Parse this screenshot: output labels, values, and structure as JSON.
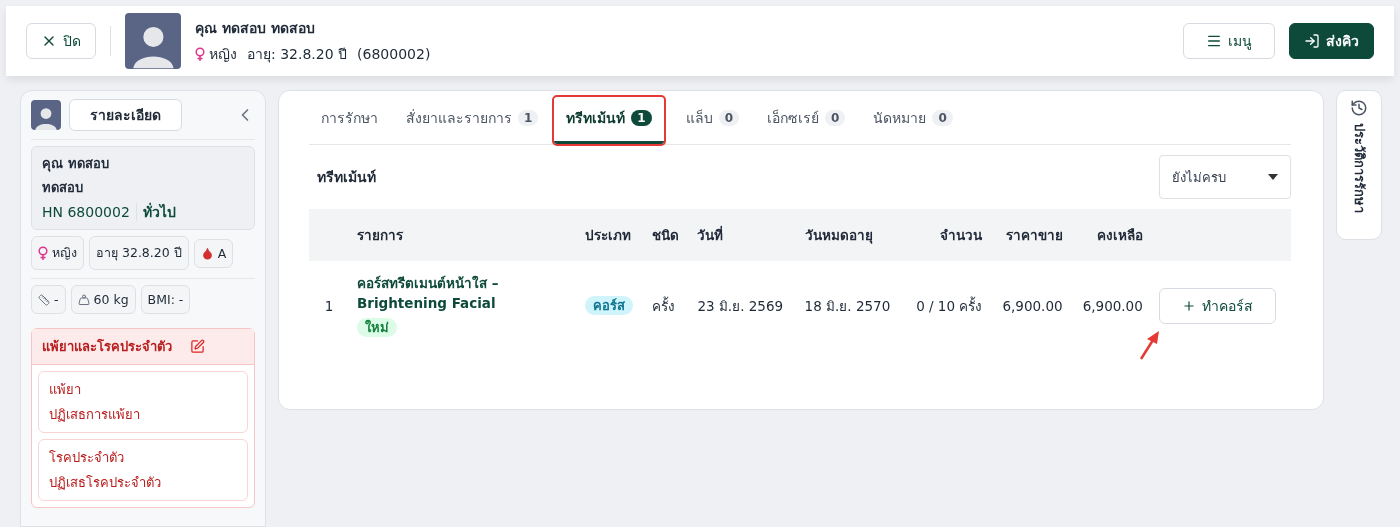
{
  "header": {
    "close_label": "ปิด",
    "patient_name": "คุณ ทดสอบ ทดสอบ",
    "gender": "หญิง",
    "age": "อายุ: 32.8.20 ปี",
    "patient_id": "(6800002)",
    "menu_label": "เมนู",
    "send_label": "ส่งคิว"
  },
  "sidebar": {
    "details_label": "รายละเอียด",
    "name_line1": "คุณ ทดสอบ",
    "name_line2": "ทดสอบ",
    "hn": "HN 6800002",
    "patient_type": "ทั่วไป",
    "chips": [
      {
        "kind": "gender",
        "text": "หญิง"
      },
      {
        "kind": "plain",
        "text": "อายุ 32.8.20 ปี"
      },
      {
        "kind": "blood",
        "text": "A"
      }
    ],
    "vitals": [
      {
        "kind": "height",
        "text": "-"
      },
      {
        "kind": "weight",
        "text": "60 kg"
      },
      {
        "kind": "plain",
        "text": "BMI: -"
      }
    ],
    "allergy_title": "แพ้ยาและโรคประจำตัว",
    "allergy_cards": [
      {
        "title": "แพ้ยา",
        "value": "ปฏิเสธการแพ้ยา"
      },
      {
        "title": "โรคประจำตัว",
        "value": "ปฏิเสธโรคประจำตัว"
      }
    ]
  },
  "tabs": [
    {
      "label": "การรักษา",
      "selected": false,
      "highlighted": false
    },
    {
      "label": "สั่งยาและรายการ",
      "count": "1",
      "selected": false,
      "highlighted": false
    },
    {
      "label": "ทรีทเม้นท์",
      "count": "1",
      "selected": true,
      "highlighted": true
    },
    {
      "label": "แล็บ",
      "count": "0",
      "selected": false,
      "highlighted": false
    },
    {
      "label": "เอ็กซเรย์",
      "count": "0",
      "selected": false,
      "highlighted": false
    },
    {
      "label": "นัดหมาย",
      "count": "0",
      "selected": false,
      "highlighted": false
    }
  ],
  "section_title": "ทรีทเม้นท์",
  "filter": {
    "value": "ยังไม่ครบ"
  },
  "table": {
    "columns": [
      "",
      "รายการ",
      "ประเภท",
      "ชนิด",
      "วันที่",
      "วันหมดอายุ",
      "จำนวน",
      "ราคาขาย",
      "คงเหลือ",
      ""
    ],
    "rows": [
      {
        "no": "1",
        "name": "คอร์สทรีตเมนต์หน้าใส – Brightening Facial",
        "new_badge": "ใหม่",
        "type": "คอร์ส",
        "unit": "ครั้ง",
        "date": "23 มิ.ย. 2569",
        "expiry": "18 มิ.ย. 2570",
        "quantity": "0 / 10 ครั้ง",
        "price": "6,900.00",
        "remaining": "6,900.00",
        "action": "ทำคอร์ส",
        "annotated": true
      }
    ]
  },
  "history_label": "ประวัติการรักษา"
}
